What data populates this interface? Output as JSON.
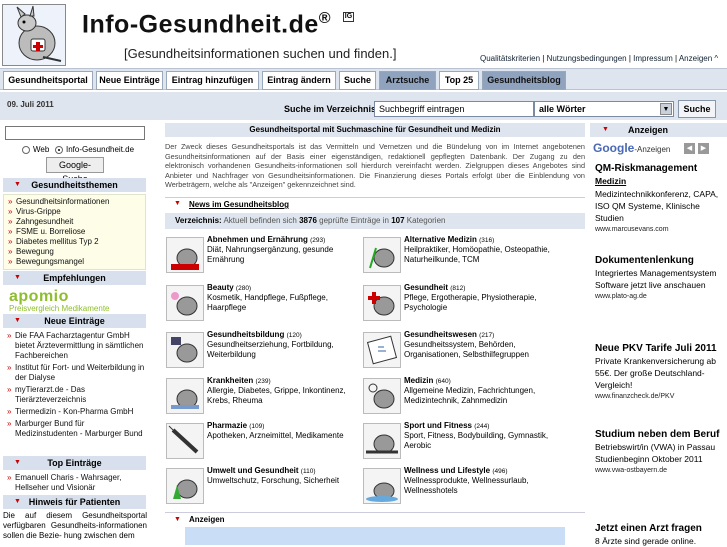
{
  "header": {
    "title": "Info-Gesundheit.de",
    "reg": "®",
    "badge": "IG",
    "subtitle": "[Gesundheitsinformationen suchen und finden.]",
    "links": [
      "Qualitätskriterien",
      "Nutzungsbedingungen",
      "Impressum",
      "Anzeigen ^"
    ]
  },
  "nav": {
    "tabs": [
      {
        "label": "Gesundheitsportal"
      },
      {
        "label": "Neue Einträge"
      },
      {
        "label": "Eintrag hinzufügen"
      },
      {
        "label": "Eintrag ändern"
      },
      {
        "label": "Suche"
      },
      {
        "label": "Arztsuche"
      },
      {
        "label": "Top 25"
      },
      {
        "label": "Gesundheitsblog"
      }
    ]
  },
  "subbar": {
    "date": "09. Juli 2011",
    "search_label": "Suche im Verzeichnis:",
    "search_value": "Suchbegriff eintragen",
    "mode_value": "alle Wörter",
    "search_button": "Suche"
  },
  "left": {
    "radio_web": "Web",
    "radio_site": "Info-Gesundheit.de",
    "google_button": "Google-Suche",
    "themen_head": "Gesundheitsthemen",
    "themen": [
      "Gesundheitsinformationen",
      "Virus-Grippe",
      "Zahngesundheit",
      "FSME u. Borreliose",
      "Diabetes mellitus Typ 2",
      "Bewegung",
      "Bewegungsmangel"
    ],
    "empf_head": "Empfehlungen",
    "apomio": "apomio",
    "apomio_sub": "Preisvergleich Medikamente",
    "neue_head": "Neue Einträge",
    "neue": [
      "Die FAA Facharztagentur GmbH bietet Ärztevermittlung in sämtlichen Fachbereichen",
      "Institut für Fort- und Weiterbildung in der Dialyse",
      "myTierarzt.de - Das Tierärzteverzeichnis",
      "Tiermedizin - Kon-Pharma GmbH",
      "Marburger Bund für Medizinstudenten - Marburger Bund"
    ],
    "top_head": "Top Einträge",
    "top": [
      "Emanuell Charis - Wahrsager, Hellseher und Visionär"
    ],
    "hinweis_head": "Hinweis für Patienten",
    "hinweis_text": "Die auf diesem Gesundheitsportal verfügbaren Gesundheits-informationen sollen die Bezie- hung zwischen dem"
  },
  "center": {
    "title": "Gesundheitsportal mit Suchmaschine für Gesundheit und Medizin",
    "intro": "Der Zweck dieses Gesundheitsportals ist das Vermitteln und Vernetzen und die Bündelung von im Internet angebotenen Gesundheitsinformationen auf der Basis einer eigenständigen, redaktionell gepflegten Datenbank. Der Zugang zu den elektronisch vorhandenen Gesundheits-informationen soll hierdurch vereinfacht werden. Zielgruppen dieses Angebotes sind Anbieter und Nachfrager von Gesundheitsinformationen. Die Finanzierung dieses Portals erfolgt über die Einblendung von Werbeträgern, welche als \"Anzeigen\" gekennzeichnet sind.",
    "news_link": "News im Gesundheitsblog",
    "vz_label": "Verzeichnis:",
    "vz_pre": "Aktuell befinden sich",
    "vz_count": "3876",
    "vz_mid": "geprüfte Einträge in",
    "vz_cats": "107",
    "vz_post": "Kategorien",
    "categories": [
      {
        "title": "Abnehmen und Ernährung",
        "count": "(293)",
        "sub": "Diät, Nahrungsergänzung, gesunde Ernährung"
      },
      {
        "title": "Alternative Medizin",
        "count": "(316)",
        "sub": "Heilpraktiker, Homöopathie, Osteopathie, Naturheilkunde, TCM"
      },
      {
        "title": "Beauty",
        "count": "(280)",
        "sub": "Kosmetik, Handpflege, Fußpflege, Haarpflege"
      },
      {
        "title": "Gesundheit",
        "count": "(812)",
        "sub": "Pflege, Ergotherapie, Physiotherapie, Psychologie"
      },
      {
        "title": "Gesundheitsbildung",
        "count": "(120)",
        "sub": "Gesundheitserziehung, Fortbildung, Weiterbildung"
      },
      {
        "title": "Gesundheitswesen",
        "count": "(217)",
        "sub": "Gesundheitssystem, Behörden, Organisationen, Selbsthilfegruppen"
      },
      {
        "title": "Krankheiten",
        "count": "(239)",
        "sub": "Allergie, Diabetes, Grippe, Inkontinenz, Krebs, Rheuma"
      },
      {
        "title": "Medizin",
        "count": "(640)",
        "sub": "Allgemeine Medizin, Fachrichtungen, Medizintechnik, Zahnmedizin"
      },
      {
        "title": "Pharmazie",
        "count": "(109)",
        "sub": "Apotheken, Arzneimittel, Medikamente"
      },
      {
        "title": "Sport und Fitness",
        "count": "(244)",
        "sub": "Sport, Fitness, Bodybuilding, Gymnastik, Aerobic"
      },
      {
        "title": "Umwelt und Gesundheit",
        "count": "(110)",
        "sub": "Umweltschutz, Forschung, Sicherheit"
      },
      {
        "title": "Wellness und Lifestyle",
        "count": "(496)",
        "sub": "Wellnessprodukte, Wellnessurlaub, Wellnesshotels"
      }
    ],
    "anzeigen": "Anzeigen"
  },
  "right": {
    "head": "Anzeigen",
    "google_ads": "Google",
    "google_ads_suffix": "-Anzeigen",
    "ads": [
      {
        "h": "QM-Riskmanagement",
        "h2": "Medizin",
        "b": "Medizintechnikkonferenz, CAPA, ISO QM Systeme, Klinische Studien",
        "u": "www.marcusevans.com"
      },
      {
        "h": "Dokumentenlenkung",
        "b": "Integriertes Managementsystem Software jetzt live anschauen",
        "u": "www.plato-ag.de"
      },
      {
        "h": "Neue PKV Tarife Juli 2011",
        "b": "Private Krankenversicherung ab 55€. Der große Deutschland-Vergleich!",
        "u": "www.finanzcheck.de/PKV"
      },
      {
        "h": "Studium neben dem Beruf",
        "b": "Betriebswirt/in (VWA) in Passau Studienbeginn Oktober 2011",
        "u": "www.vwa-ostbayern.de"
      },
      {
        "h": "Jetzt einen Arzt fragen",
        "b": "8 Ärzte sind gerade online."
      }
    ]
  }
}
